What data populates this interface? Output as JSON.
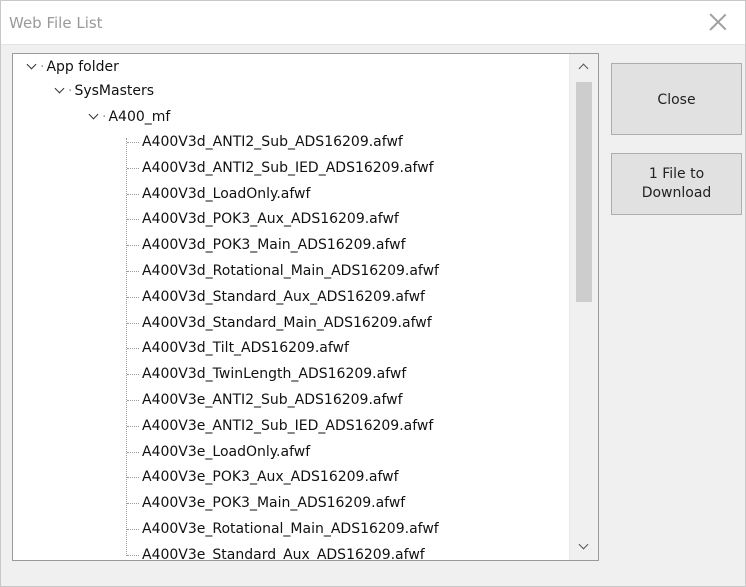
{
  "window": {
    "title": "Web File List"
  },
  "buttons": {
    "close": "Close",
    "download_line1": "1 File to",
    "download_line2": "Download"
  },
  "tree": {
    "root": "App folder",
    "child": "SysMasters",
    "grandchild": "A400_mf",
    "files": [
      "A400V3d_ANTI2_Sub_ADS16209.afwf",
      "A400V3d_ANTI2_Sub_IED_ADS16209.afwf",
      "A400V3d_LoadOnly.afwf",
      "A400V3d_POK3_Aux_ADS16209.afwf",
      "A400V3d_POK3_Main_ADS16209.afwf",
      "A400V3d_Rotational_Main_ADS16209.afwf",
      "A400V3d_Standard_Aux_ADS16209.afwf",
      "A400V3d_Standard_Main_ADS16209.afwf",
      "A400V3d_Tilt_ADS16209.afwf",
      "A400V3d_TwinLength_ADS16209.afwf",
      "A400V3e_ANTI2_Sub_ADS16209.afwf",
      "A400V3e_ANTI2_Sub_IED_ADS16209.afwf",
      "A400V3e_LoadOnly.afwf",
      "A400V3e_POK3_Aux_ADS16209.afwf",
      "A400V3e_POK3_Main_ADS16209.afwf",
      "A400V3e_Rotational_Main_ADS16209.afwf",
      "A400V3e_Standard_Aux_ADS16209.afwf"
    ]
  }
}
